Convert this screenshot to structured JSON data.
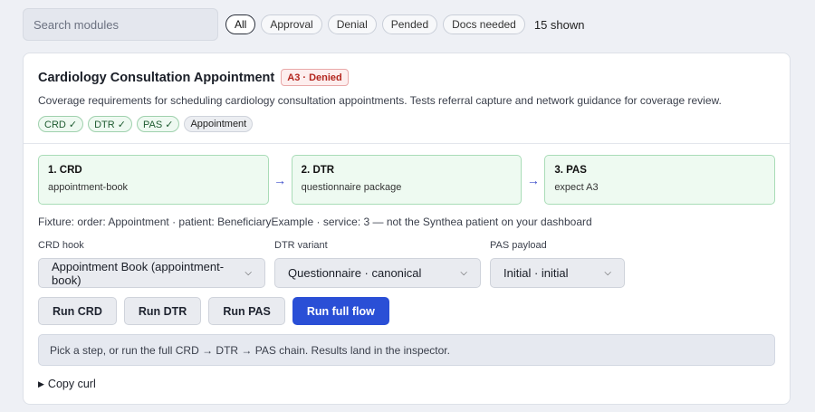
{
  "filters": {
    "search_placeholder": "Search modules",
    "chips": [
      "All",
      "Approval",
      "Denial",
      "Pended",
      "Docs needed"
    ],
    "active_chip": "All",
    "shown_count": "15 shown"
  },
  "module": {
    "title": "Cardiology Consultation Appointment",
    "status_badge": "A3 · Denied",
    "description": "Coverage requirements for scheduling cardiology consultation appointments. Tests referral capture and network guidance for coverage review.",
    "tags": [
      {
        "label": "CRD ✓",
        "kind": "ok"
      },
      {
        "label": "DTR ✓",
        "kind": "ok"
      },
      {
        "label": "PAS ✓",
        "kind": "ok"
      },
      {
        "label": "Appointment",
        "kind": "neutral"
      }
    ]
  },
  "steps": [
    {
      "title": "1. CRD",
      "sub": "appointment-book"
    },
    {
      "title": "2. DTR",
      "sub": "questionnaire package"
    },
    {
      "title": "3. PAS",
      "sub": "expect A3"
    }
  ],
  "arrow_glyph": "→",
  "fixture_text": "Fixture: order: Appointment · patient: BeneficiaryExample · service: 3 — not the Synthea patient on your dashboard",
  "selects": {
    "crd_hook": {
      "label": "CRD hook",
      "value": "Appointment Book (appointment-book)"
    },
    "dtr_variant": {
      "label": "DTR variant",
      "value": "Questionnaire · canonical"
    },
    "pas_payload": {
      "label": "PAS payload",
      "value": "Initial · initial"
    }
  },
  "buttons": {
    "run_crd": "Run CRD",
    "run_dtr": "Run DTR",
    "run_pas": "Run PAS",
    "run_full": "Run full flow"
  },
  "info_text": "Pick a step, or run the full CRD → DTR → PAS chain. Results land in the inspector.",
  "copy_curl": "Copy curl",
  "colors": {
    "primary": "#2a4fd6",
    "success_bg": "#eefaf1",
    "denied": "#b3261e"
  }
}
